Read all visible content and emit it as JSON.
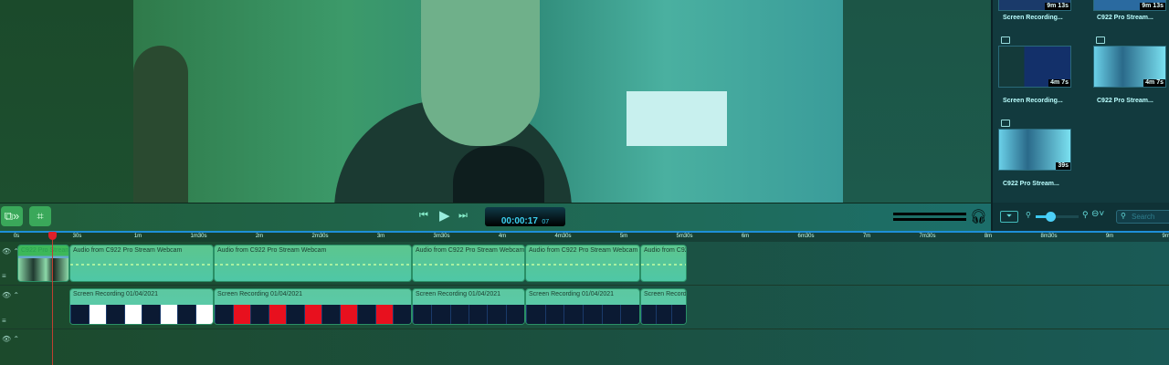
{
  "toolbar": {
    "timecode_main": "00:00:17",
    "timecode_frames": "07"
  },
  "ruler": {
    "ticks": [
      "0s",
      "30s",
      "1m",
      "1m30s",
      "2m",
      "2m30s",
      "3m",
      "3m30s",
      "4m",
      "4m30s",
      "5m",
      "5m30s",
      "6m",
      "6m30s",
      "7m",
      "7m30s",
      "8m",
      "8m30s",
      "9m",
      "9m30s"
    ]
  },
  "tracks": {
    "video_clip_title": "C922 Pro Stream",
    "audio_clips": [
      "Audio from C922 Pro Stream Webcam",
      "Audio from C922 Pro Stream Webcam",
      "Audio from C922 Pro Stream Webcam",
      "Audio from C922 Pro Stream Webcam",
      "Audio from C922 Pro Stream Webcam"
    ],
    "screen_clips": [
      "Screen Recording 01/04/2021",
      "Screen Recording 01/04/2021",
      "Screen Recording 01/04/2021",
      "Screen Recording 01/04/2021",
      "Screen Recording 01/04/2021"
    ]
  },
  "media": {
    "items": [
      {
        "name": "Screen Recording...",
        "duration": "9m 13s"
      },
      {
        "name": "C922 Pro Stream...",
        "duration": "9m 13s"
      },
      {
        "name": "Screen Recording...",
        "duration": "4m 7s"
      },
      {
        "name": "C922 Pro Stream...",
        "duration": "4m 7s"
      },
      {
        "name": "C922 Pro Stream...",
        "duration": "39s"
      }
    ],
    "search_placeholder": "Search"
  },
  "colors": {
    "playhead": "#e0202a",
    "ruler_accent": "#1e8fd8"
  }
}
